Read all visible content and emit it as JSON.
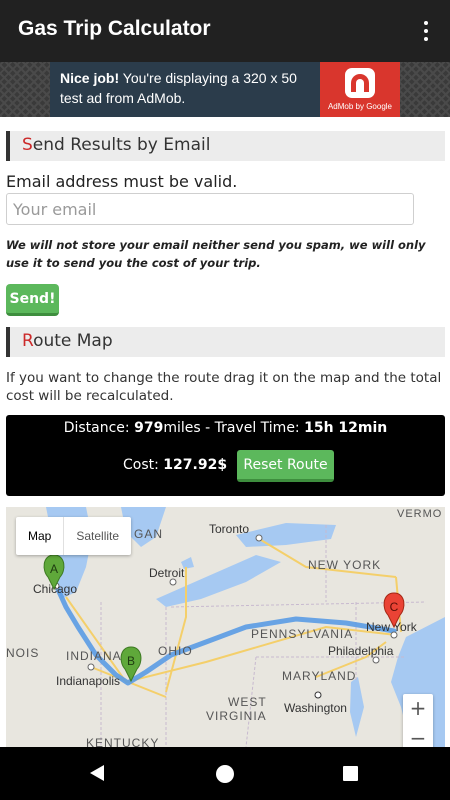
{
  "app": {
    "title": "Gas Trip Calculator"
  },
  "ad": {
    "bold": "Nice job!",
    "text": " You're displaying a 320 x 50 test ad from AdMob.",
    "brand": "AdMob by Google"
  },
  "email_section": {
    "heading_first": "S",
    "heading_rest": "end Results by Email",
    "validation": "Email address must be valid.",
    "placeholder": "Your email",
    "value": "",
    "note": "We will not store your email neither send you spam, we will only use it to send you the cost of your trip.",
    "send_label": "Send!"
  },
  "route_section": {
    "heading_first": "R",
    "heading_rest": "oute Map",
    "instructions": "If you want to change the route drag it on the map and the total cost will be recalculated."
  },
  "summary": {
    "distance_label": "Distance: ",
    "distance_value": "979",
    "distance_unit": "miles - Travel Time: ",
    "travel_time": "15h 12min",
    "cost_label": "Cost: ",
    "cost_value": "127.92",
    "currency": "$",
    "reset_label": "Reset Route"
  },
  "map": {
    "type_map": "Map",
    "type_satellite": "Satellite",
    "zoom_in": "+",
    "zoom_out": "−",
    "markers": [
      "A",
      "B",
      "C"
    ],
    "labels": {
      "toronto": "Toronto",
      "vermont": "VERMO",
      "michigan": "GAN",
      "detroit": "Detroit",
      "newyork_state": "NEW YORK",
      "chicago": "Chicago",
      "pennsylvania": "PENNSYLVANIA",
      "newyork_city": "New York",
      "ohio": "OHIO",
      "illinois": "NOIS",
      "indiana": "INDIANA",
      "indianapolis": "Indianapolis",
      "philadelphia": "Philadelphia",
      "maryland": "MARYLAND",
      "westvirginia1": "WEST",
      "westvirginia2": "VIRGINIA",
      "washington": "Washington",
      "kentucky": "KENTUCKY"
    },
    "colors": {
      "route": "#5a9be4",
      "water": "#a6c9f2",
      "land": "#e8e6df",
      "marker_green": "#5fa83a",
      "marker_red": "#ea4335"
    }
  },
  "icons": [
    "overflow-menu-icon",
    "admob-logo-icon",
    "back-icon",
    "home-icon",
    "recents-icon"
  ]
}
